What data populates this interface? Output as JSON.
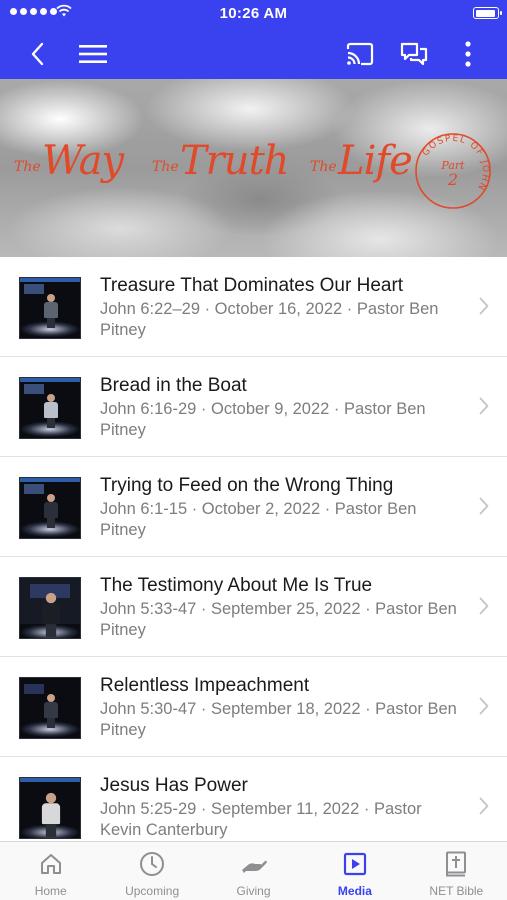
{
  "status_bar": {
    "time": "10:26 AM"
  },
  "nav": {
    "back_icon": "chevron-left-icon",
    "menu_icon": "hamburger-menu-icon",
    "cast_icon": "cast-icon",
    "chat_icon": "chat-bubbles-icon",
    "more_icon": "more-vertical-icon"
  },
  "banner": {
    "the_1": "The",
    "way": "Way",
    "the_2": "The",
    "truth": "Truth",
    "the_3": "The",
    "life": "Life",
    "badge_arc": "GOSPEL OF JOHN",
    "badge_part": "Part",
    "badge_num": "2"
  },
  "sermons": [
    {
      "title": "Treasure That Dominates Our Heart",
      "meta": "John 6:22–29 · October 16, 2022 · Pastor Ben Pitney"
    },
    {
      "title": "Bread in the Boat",
      "meta": "John 6:16-29 · October 9, 2022 · Pastor Ben Pitney"
    },
    {
      "title": "Trying to Feed on the Wrong Thing",
      "meta": "John 6:1-15 · October 2, 2022 · Pastor Ben Pitney"
    },
    {
      "title": "The Testimony About Me Is True",
      "meta": "John 5:33-47 · September 25, 2022 · Pastor Ben Pitney"
    },
    {
      "title": "Relentless Impeachment",
      "meta": "John 5:30-47 · September 18, 2022 · Pastor Ben Pitney"
    },
    {
      "title": "Jesus Has Power",
      "meta": "John 5:25-29 · September 11, 2022 · Pastor Kevin Canterbury"
    }
  ],
  "tabs": [
    {
      "label": "Home",
      "icon": "home-icon"
    },
    {
      "label": "Upcoming",
      "icon": "clock-icon"
    },
    {
      "label": "Giving",
      "icon": "giving-hand-icon"
    },
    {
      "label": "Media",
      "icon": "media-play-icon"
    },
    {
      "label": "NET Bible",
      "icon": "bible-icon"
    }
  ],
  "colors": {
    "accent": "#3a41ee",
    "banner_text": "#e04a2a"
  }
}
